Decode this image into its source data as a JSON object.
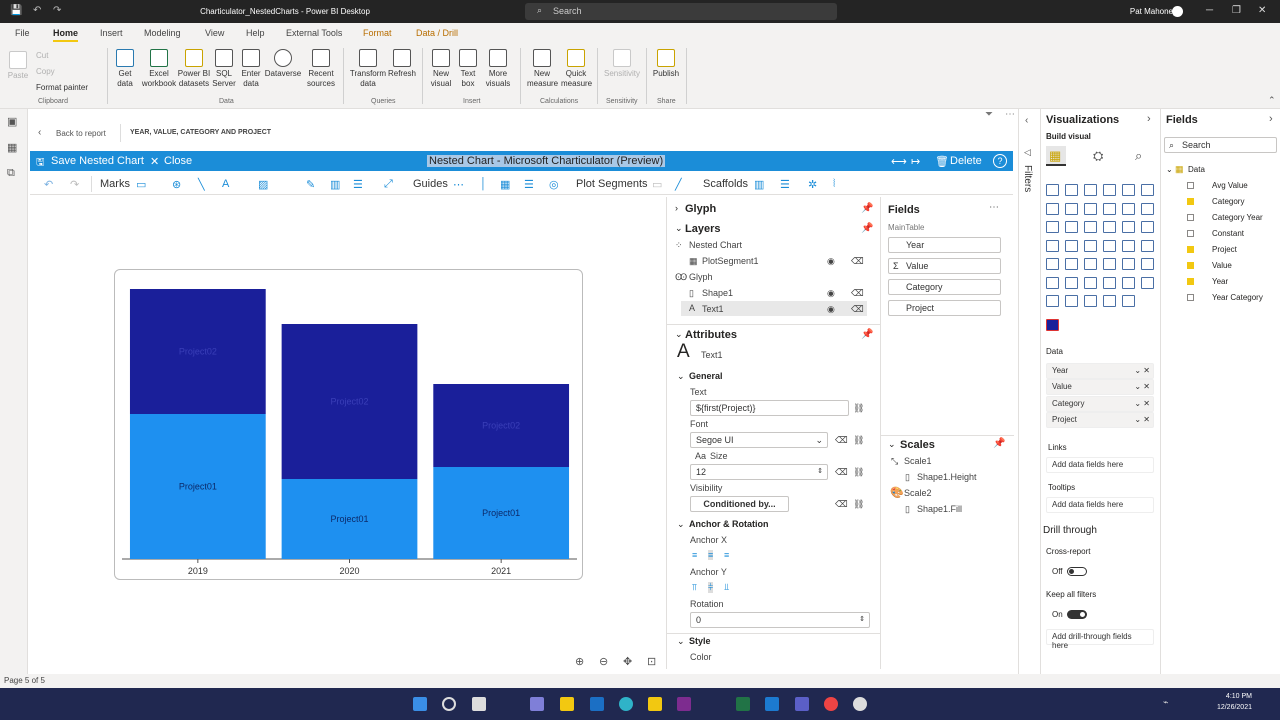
{
  "window": {
    "title": "Charticulator_NestedCharts - Power BI Desktop",
    "search": "Search",
    "user": "Pat Mahoney"
  },
  "menu": {
    "items": [
      "File",
      "Home",
      "Insert",
      "Modeling",
      "View",
      "Help",
      "External Tools",
      "Format",
      "Data / Drill"
    ],
    "selected": "Home"
  },
  "ribbon": {
    "clipboard": {
      "paste": "Paste",
      "cut": "Cut",
      "copy": "Copy",
      "format_painter": "Format painter",
      "group": "Clipboard"
    },
    "data": {
      "get_data": "Get data",
      "excel": "Excel workbook",
      "pbi": "Power BI datasets",
      "sql": "SQL Server",
      "enter": "Enter data",
      "dataverse": "Dataverse",
      "recent": "Recent sources",
      "group": "Data"
    },
    "queries": {
      "transform": "Transform data",
      "refresh": "Refresh",
      "group": "Queries"
    },
    "insert": {
      "new_visual": "New visual",
      "text_box": "Text box",
      "more": "More visuals",
      "group": "Insert"
    },
    "calc": {
      "new_measure": "New measure",
      "quick": "Quick measure",
      "group": "Calculations"
    },
    "sensitivity": {
      "label": "Sensitivity",
      "group": "Sensitivity"
    },
    "share": {
      "publish": "Publish",
      "group": "Share"
    }
  },
  "report": {
    "back": "Back to report",
    "crumb": "YEAR, VALUE, CATEGORY AND PROJECT"
  },
  "editor": {
    "save": "Save Nested Chart",
    "close": "Close",
    "title": "Nested Chart - Microsoft Charticulator (Preview)",
    "delete": "Delete"
  },
  "toolbar": {
    "marks": "Marks",
    "guides": "Guides",
    "plot_segments": "Plot Segments",
    "scaffolds": "Scaffolds"
  },
  "chart_data": {
    "type": "bar",
    "stacked": true,
    "categories": [
      "2019",
      "2020",
      "2021"
    ],
    "ylim": [
      0,
      270
    ],
    "series": [
      {
        "name": "Project01",
        "values": [
          145,
          80,
          92
        ],
        "color": "#1e90f0"
      },
      {
        "name": "Project02",
        "values": [
          125,
          155,
          83
        ],
        "color": "#1a1f9a"
      }
    ]
  },
  "glyph": {
    "title": "Glyph"
  },
  "layers": {
    "title": "Layers",
    "nested": "Nested Chart",
    "plot": "PlotSegment1",
    "glyph": "Glyph",
    "shape": "Shape1",
    "text": "Text1"
  },
  "attributes": {
    "title": "Attributes",
    "name": "Text1",
    "general": "General",
    "text_label": "Text",
    "text_value": "${first(Project)}",
    "font_label": "Font",
    "font_value": "Segoe UI",
    "size_label": "Size",
    "size_value": "12",
    "visibility_label": "Visibility",
    "visibility_btn": "Conditioned by...",
    "anchor": "Anchor & Rotation",
    "anchor_x": "Anchor X",
    "anchor_y": "Anchor Y",
    "rotation": "Rotation",
    "rotation_value": "0",
    "style": "Style",
    "color": "Color"
  },
  "fields": {
    "title": "Fields",
    "table": "MainTable",
    "items": [
      "Year",
      "Value",
      "Category",
      "Project"
    ]
  },
  "scales": {
    "title": "Scales",
    "s1": "Scale1",
    "s1p": "Shape1.Height",
    "s2": "Scale2",
    "s2p": "Shape1.Fill"
  },
  "filters_tab": "Filters",
  "vis": {
    "title": "Visualizations",
    "build": "Build visual",
    "data": "Data",
    "wells": [
      "Year",
      "Value",
      "Category",
      "Project"
    ],
    "links": "Links",
    "add_here": "Add data fields here",
    "tooltips": "Tooltips",
    "drill": "Drill through",
    "cross": "Cross-report",
    "off": "Off",
    "keep": "Keep all filters",
    "on": "On",
    "add_drill": "Add drill-through fields here"
  },
  "fields_pane": {
    "title": "Fields",
    "search": "Search",
    "table": "Data",
    "items": [
      {
        "name": "Avg Value",
        "checked": false
      },
      {
        "name": "Category",
        "checked": true
      },
      {
        "name": "Category Year",
        "checked": false
      },
      {
        "name": "Constant",
        "checked": false
      },
      {
        "name": "Project",
        "checked": true
      },
      {
        "name": "Value",
        "checked": true
      },
      {
        "name": "Year",
        "checked": true
      },
      {
        "name": "Year Category",
        "checked": false
      }
    ]
  },
  "status": {
    "page": "Page 5 of 5"
  },
  "taskbar": {
    "time": "4:10 PM",
    "date": "12/26/2021"
  }
}
